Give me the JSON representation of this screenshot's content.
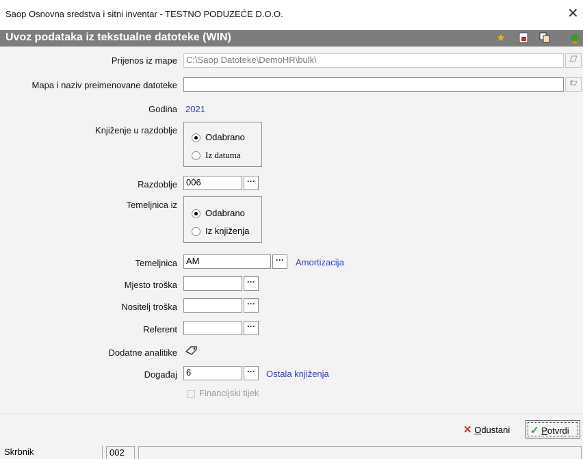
{
  "window": {
    "title": "Saop Osnovna sredstva i sitni inventar  - TESTNO PODUZEĆE D.O.O.",
    "close_glyph": "✕"
  },
  "header": {
    "title": "Uvoz podataka iz tekstualne datoteke (WIN)",
    "icons": [
      "star-icon",
      "pdf-export-icon",
      "copy-icon",
      "help-icon"
    ]
  },
  "form": {
    "prijenos_label": "Prijenos iz mape",
    "prijenos_value": "C:\\Saop Datoteke\\DemoHR\\bulk\\",
    "mapa_label": "Mapa i naziv preimenovane datoteke",
    "mapa_value": "",
    "godina_label": "Godina",
    "godina_value": "2021",
    "knjizenje_label": "Knjiženje u razdoblje",
    "knjizenje_options": [
      "Odabrano",
      "Iz datuma"
    ],
    "razdoblje_label": "Razdoblje",
    "razdoblje_value": "006",
    "temeljnica_iz_label": "Temeljnica iz",
    "temeljnica_iz_options": [
      "Odabrano",
      "Iz knjiženja"
    ],
    "temeljnica_label": "Temeljnica",
    "temeljnica_value": "AM",
    "temeljnica_desc": "Amortizacija",
    "mjesto_label": "Mjesto troška",
    "mjesto_value": "",
    "nositelj_label": "Nositelj troška",
    "nositelj_value": "",
    "referent_label": "Referent",
    "referent_value": "",
    "dodatne_label": "Dodatne analitike",
    "dogadaj_label": "Događaj",
    "dogadaj_value": "6",
    "dogadaj_desc": "Ostala knjiženja",
    "financijski_label": "Financijski tijek",
    "dots": "···"
  },
  "footer": {
    "odustani_u": "O",
    "odustani_rest": "dustani",
    "potvrdi_u": "P",
    "potvrdi_rest": "otvrdi"
  },
  "status": {
    "cell1": "Skrbnik",
    "cell2": "002",
    "cell3": ""
  },
  "colors": {
    "header_bg": "#7d7d7d",
    "link_blue": "#2a3fc6",
    "cancel_red": "#c0392b",
    "confirm_green": "#2e9a2e"
  }
}
